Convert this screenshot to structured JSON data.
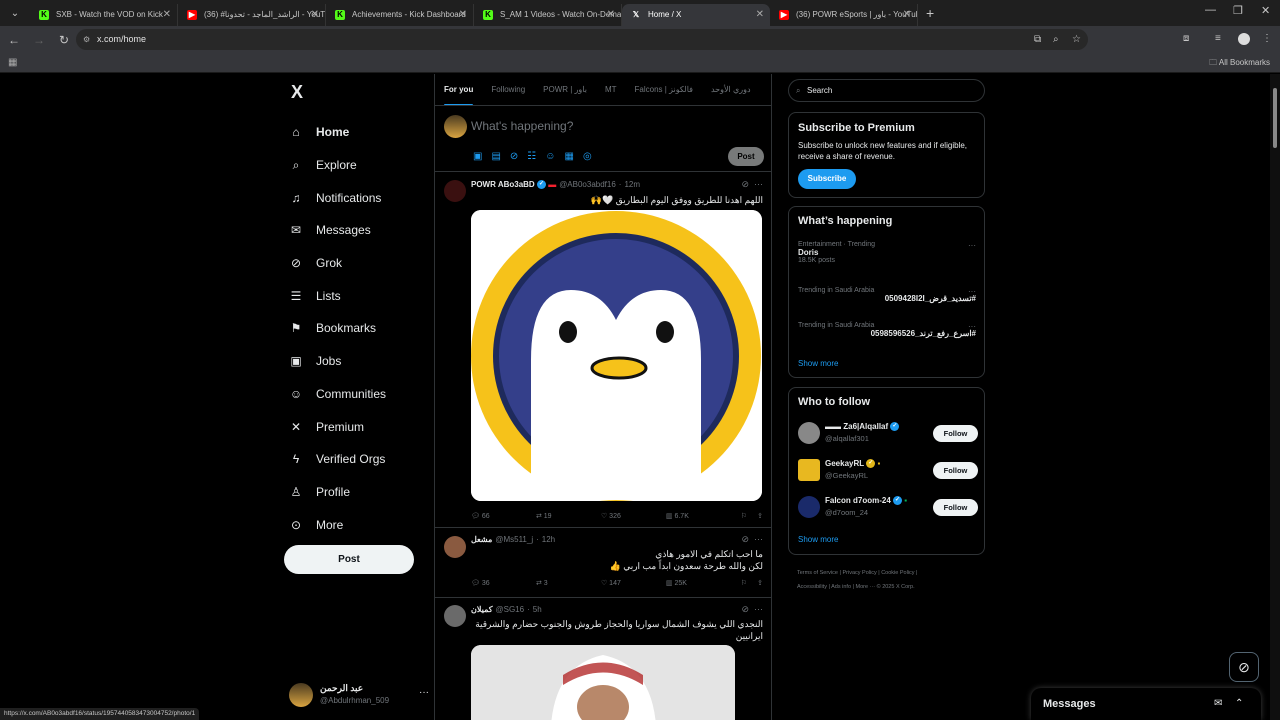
{
  "browser": {
    "tabs": [
      {
        "title": "SXB - Watch the VOD on Kick",
        "icon": "kick-icon"
      },
      {
        "title": "(36) #الراشد_الماجد - تحدونا - YouTube",
        "icon": "youtube-icon"
      },
      {
        "title": "Achievements - Kick Dashboard",
        "icon": "kick-icon"
      },
      {
        "title": "S_AM 1 Videos - Watch On-Demand",
        "icon": "kick-icon"
      },
      {
        "title": "Home / X",
        "icon": "x-icon"
      },
      {
        "title": "(36) POWR eSports | باور - YouTube",
        "icon": "youtube-icon"
      }
    ],
    "url": "x.com/home",
    "bookmarks_label": "All Bookmarks",
    "status_url": "https://x.com/AB0o3abdf16/status/1957440583473004752/photo/1"
  },
  "sidebar": {
    "logo": "X",
    "items": [
      {
        "label": "Home",
        "icon": "home-icon"
      },
      {
        "label": "Explore",
        "icon": "search-icon"
      },
      {
        "label": "Notifications",
        "icon": "bell-icon"
      },
      {
        "label": "Messages",
        "icon": "envelope-icon"
      },
      {
        "label": "Grok",
        "icon": "grok-icon"
      },
      {
        "label": "Lists",
        "icon": "list-icon"
      },
      {
        "label": "Bookmarks",
        "icon": "bookmark-icon"
      },
      {
        "label": "Jobs",
        "icon": "briefcase-icon"
      },
      {
        "label": "Communities",
        "icon": "people-icon"
      },
      {
        "label": "Premium",
        "icon": "x-icon"
      },
      {
        "label": "Verified Orgs",
        "icon": "lightning-icon"
      },
      {
        "label": "Profile",
        "icon": "person-icon"
      },
      {
        "label": "More",
        "icon": "more-circle-icon"
      }
    ],
    "post_label": "Post",
    "account": {
      "name": "عبد الرحمن",
      "handle": "@Abdulrhman_509"
    }
  },
  "feed": {
    "tabs": [
      "For you",
      "Following",
      "POWR | باور",
      "MT",
      "Falcons | فالكونز",
      "دوري الأوحد"
    ],
    "compose_placeholder": "What's happening?",
    "compose_post": "Post",
    "tweets": [
      {
        "name": "POWR ABo3aBD",
        "handle": "@AB0o3abdf16",
        "time": "12m",
        "text": "اللهم اهدنا للطريق ووفق اليوم البطاريق 🤍🙌",
        "stats": {
          "replies": "66",
          "reposts": "19",
          "likes": "326",
          "views": "6.7K"
        }
      },
      {
        "name": "مشعل",
        "handle": "@Ms511_j",
        "time": "12h",
        "text": "ما احب اتكلم في الامور هاذي\nلكن والله طرحة سعدون ابداً مب اربي 👍",
        "stats": {
          "replies": "36",
          "reposts": "3",
          "likes": "147",
          "views": "25K"
        }
      },
      {
        "name": "كميلان",
        "handle": "@SG16",
        "time": "5h",
        "text": "النجدي اللي يشوف الشمال سواريا والحجاز طروش والجنوب حضارم والشرقية ايرانيين"
      }
    ]
  },
  "right": {
    "search_placeholder": "Search",
    "premium": {
      "title": "Subscribe to Premium",
      "body": "Subscribe to unlock new features and if eligible, receive a share of revenue.",
      "button": "Subscribe"
    },
    "happening": {
      "title": "What’s happening",
      "trends": [
        {
          "category": "Entertainment · Trending",
          "title": "Doris",
          "count": "18.5K posts"
        },
        {
          "category": "Trending in Saudi Arabia",
          "title": "#تسديد_قرض_0509428I2I",
          "count": ""
        },
        {
          "category": "Trending in Saudi Arabia",
          "title": "#اسرع_رفع_ترند_0598596526",
          "count": ""
        }
      ],
      "show_more": "Show more"
    },
    "who_to_follow": {
      "title": "Who to follow",
      "users": [
        {
          "name": "Za6|Alqallaf",
          "handle": "@alqallaf301"
        },
        {
          "name": "GeekayRL",
          "handle": "@GeekayRL"
        },
        {
          "name": "Falcon d7oom-24",
          "handle": "@d7oom_24"
        }
      ],
      "follow_label": "Follow",
      "show_more": "Show more"
    },
    "footer": [
      "Terms of Service",
      "Privacy Policy",
      "Cookie Policy",
      "Accessibility",
      "Ads info",
      "More ···",
      "© 2025 X Corp."
    ]
  },
  "messages_drawer": {
    "title": "Messages"
  }
}
